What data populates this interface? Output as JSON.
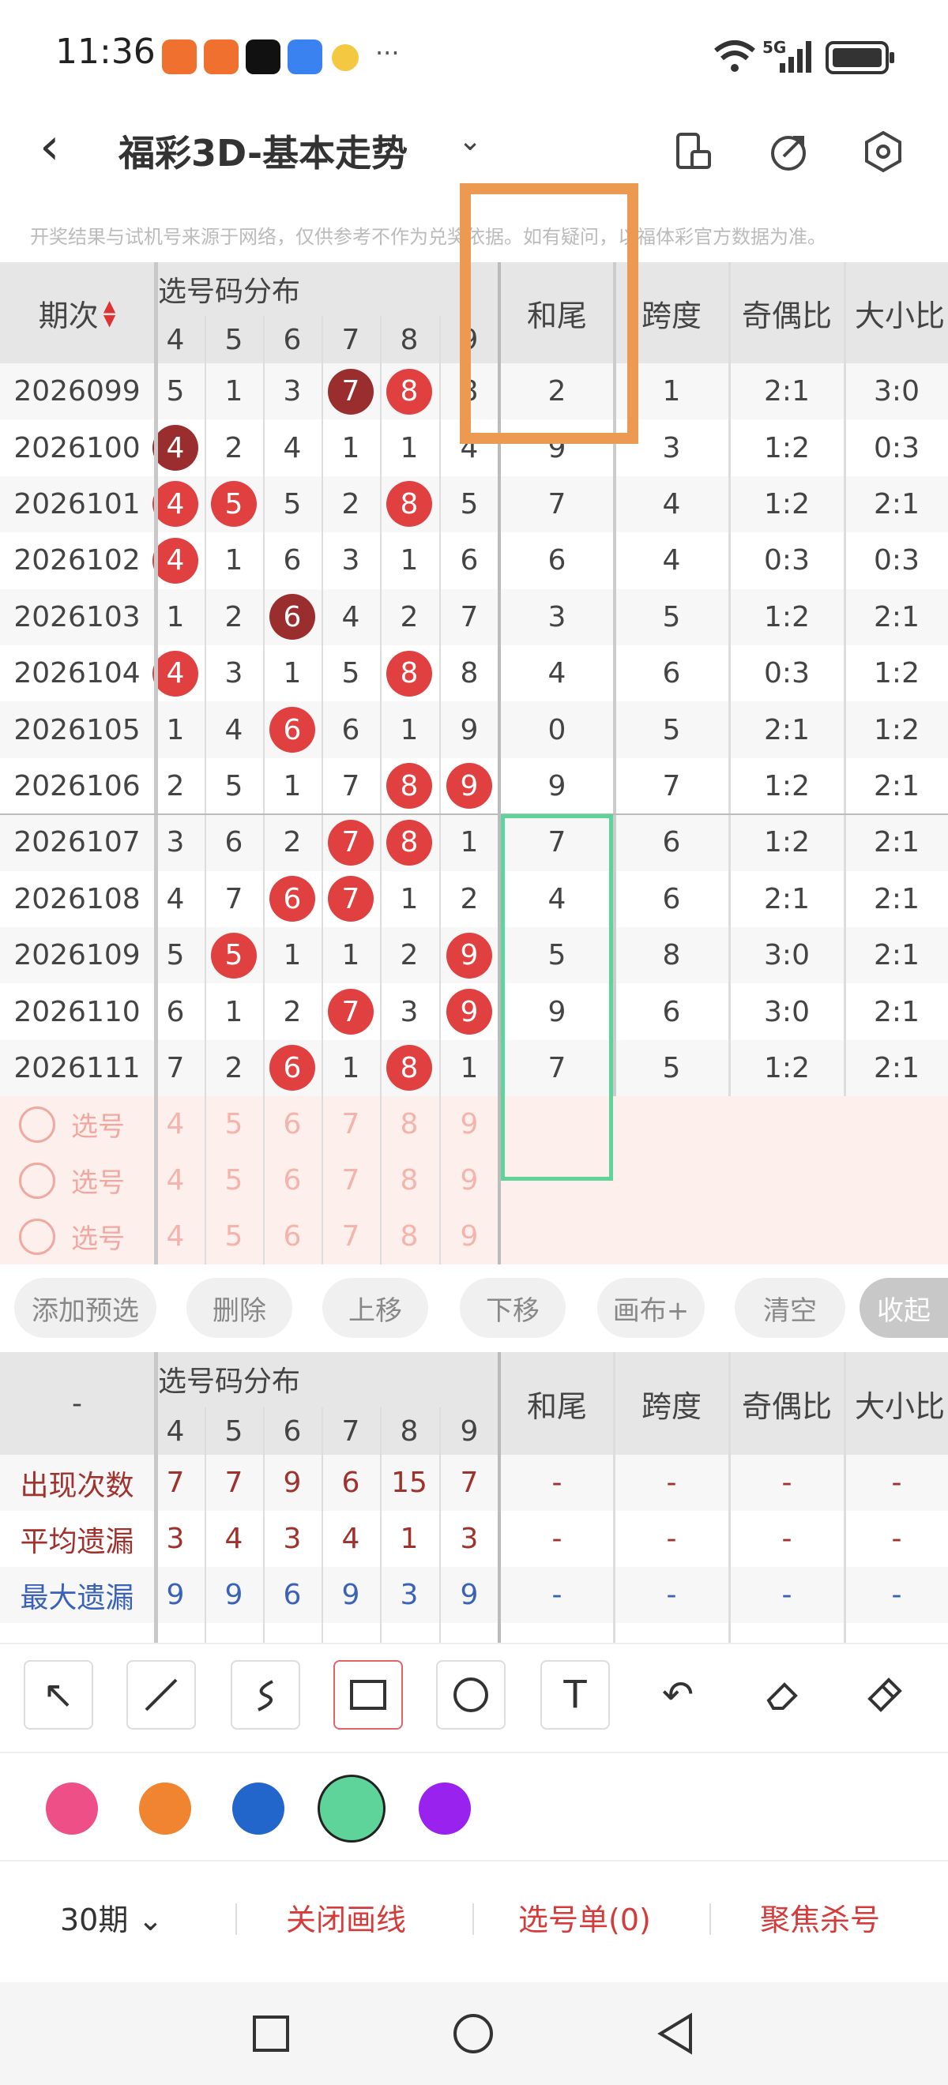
{
  "status": {
    "time": "11:36",
    "more": "···",
    "signal": "5G"
  },
  "nav": {
    "title": "福彩3D-基本走势"
  },
  "notice": "开奖结果与试机号来源于网络，仅供参考不作为兑奖依据。如有疑问，以福体彩官方数据为准。",
  "table": {
    "col_period": "期次",
    "col_dist": "选号码分布",
    "col_hewei": "和尾",
    "col_kuadu": "跨度",
    "col_qiou": "奇偶比",
    "col_daxiao": "大小比",
    "digits": [
      "4",
      "5",
      "6",
      "7",
      "8",
      "9"
    ],
    "rows": [
      {
        "p": "2026099",
        "d": [
          "5",
          "1",
          "3",
          "7",
          "8",
          "8"
        ],
        "b": [
          0,
          0,
          0,
          2,
          1,
          0
        ],
        "h": "2",
        "k": "1",
        "q": "2:1",
        "x": "3:0"
      },
      {
        "p": "2026100",
        "d": [
          "4",
          "2",
          "4",
          "1",
          "1",
          "4"
        ],
        "b": [
          2,
          0,
          0,
          0,
          0,
          0
        ],
        "h": "9",
        "k": "3",
        "q": "1:2",
        "x": "0:3"
      },
      {
        "p": "2026101",
        "d": [
          "4",
          "5",
          "5",
          "2",
          "8",
          "5"
        ],
        "b": [
          1,
          1,
          0,
          0,
          1,
          0
        ],
        "h": "7",
        "k": "4",
        "q": "1:2",
        "x": "2:1"
      },
      {
        "p": "2026102",
        "d": [
          "4",
          "1",
          "6",
          "3",
          "1",
          "6"
        ],
        "b": [
          1,
          0,
          0,
          0,
          0,
          0
        ],
        "h": "6",
        "k": "4",
        "q": "0:3",
        "x": "0:3"
      },
      {
        "p": "2026103",
        "d": [
          "1",
          "2",
          "6",
          "4",
          "2",
          "7"
        ],
        "b": [
          0,
          0,
          2,
          0,
          0,
          0
        ],
        "h": "3",
        "k": "5",
        "q": "1:2",
        "x": "2:1"
      },
      {
        "p": "2026104",
        "d": [
          "4",
          "3",
          "1",
          "5",
          "8",
          "8"
        ],
        "b": [
          1,
          0,
          0,
          0,
          1,
          0
        ],
        "h": "4",
        "k": "6",
        "q": "0:3",
        "x": "1:2"
      },
      {
        "p": "2026105",
        "d": [
          "1",
          "4",
          "6",
          "6",
          "1",
          "9"
        ],
        "b": [
          0,
          0,
          1,
          0,
          0,
          0
        ],
        "h": "0",
        "k": "5",
        "q": "2:1",
        "x": "1:2"
      },
      {
        "p": "2026106",
        "d": [
          "2",
          "5",
          "1",
          "7",
          "8",
          "9"
        ],
        "b": [
          0,
          0,
          0,
          0,
          1,
          1
        ],
        "h": "9",
        "k": "7",
        "q": "1:2",
        "x": "2:1"
      },
      {
        "p": "2026107",
        "d": [
          "3",
          "6",
          "2",
          "7",
          "8",
          "1"
        ],
        "b": [
          0,
          0,
          0,
          1,
          1,
          0
        ],
        "h": "7",
        "k": "6",
        "q": "1:2",
        "x": "2:1"
      },
      {
        "p": "2026108",
        "d": [
          "4",
          "7",
          "6",
          "7",
          "1",
          "2"
        ],
        "b": [
          0,
          0,
          1,
          1,
          0,
          0
        ],
        "h": "4",
        "k": "6",
        "q": "2:1",
        "x": "2:1"
      },
      {
        "p": "2026109",
        "d": [
          "5",
          "5",
          "1",
          "1",
          "2",
          "9"
        ],
        "b": [
          0,
          1,
          0,
          0,
          0,
          1
        ],
        "h": "5",
        "k": "8",
        "q": "3:0",
        "x": "2:1"
      },
      {
        "p": "2026110",
        "d": [
          "6",
          "1",
          "2",
          "7",
          "3",
          "9"
        ],
        "b": [
          0,
          0,
          0,
          1,
          0,
          1
        ],
        "h": "9",
        "k": "6",
        "q": "3:0",
        "x": "2:1"
      },
      {
        "p": "2026111",
        "d": [
          "7",
          "2",
          "6",
          "1",
          "8",
          "1"
        ],
        "b": [
          0,
          0,
          1,
          0,
          1,
          0
        ],
        "h": "7",
        "k": "5",
        "q": "1:2",
        "x": "2:1"
      }
    ],
    "pick_label": "选号"
  },
  "actions": [
    "添加预选",
    "删除",
    "上移",
    "下移",
    "画布+",
    "清空",
    "收起"
  ],
  "stats": {
    "dash": "-",
    "rows": [
      {
        "label": "出现次数",
        "vals": [
          "7",
          "7",
          "9",
          "6",
          "15",
          "7"
        ],
        "color": "#a0322e"
      },
      {
        "label": "平均遗漏",
        "vals": [
          "3",
          "4",
          "3",
          "4",
          "1",
          "3"
        ],
        "color": "#a0322e"
      },
      {
        "label": "最大遗漏",
        "vals": [
          "9",
          "9",
          "6",
          "9",
          "3",
          "9"
        ],
        "color": "#3a62b8"
      }
    ]
  },
  "colors": [
    "#ee4f86",
    "#f08430",
    "#2266cc",
    "#5ed39a",
    "#9a22ee"
  ],
  "bottom": {
    "periods": "30期",
    "close_draw": "关闭画线",
    "pick_list": "选号单(0)",
    "focus_kill": "聚焦杀号"
  }
}
